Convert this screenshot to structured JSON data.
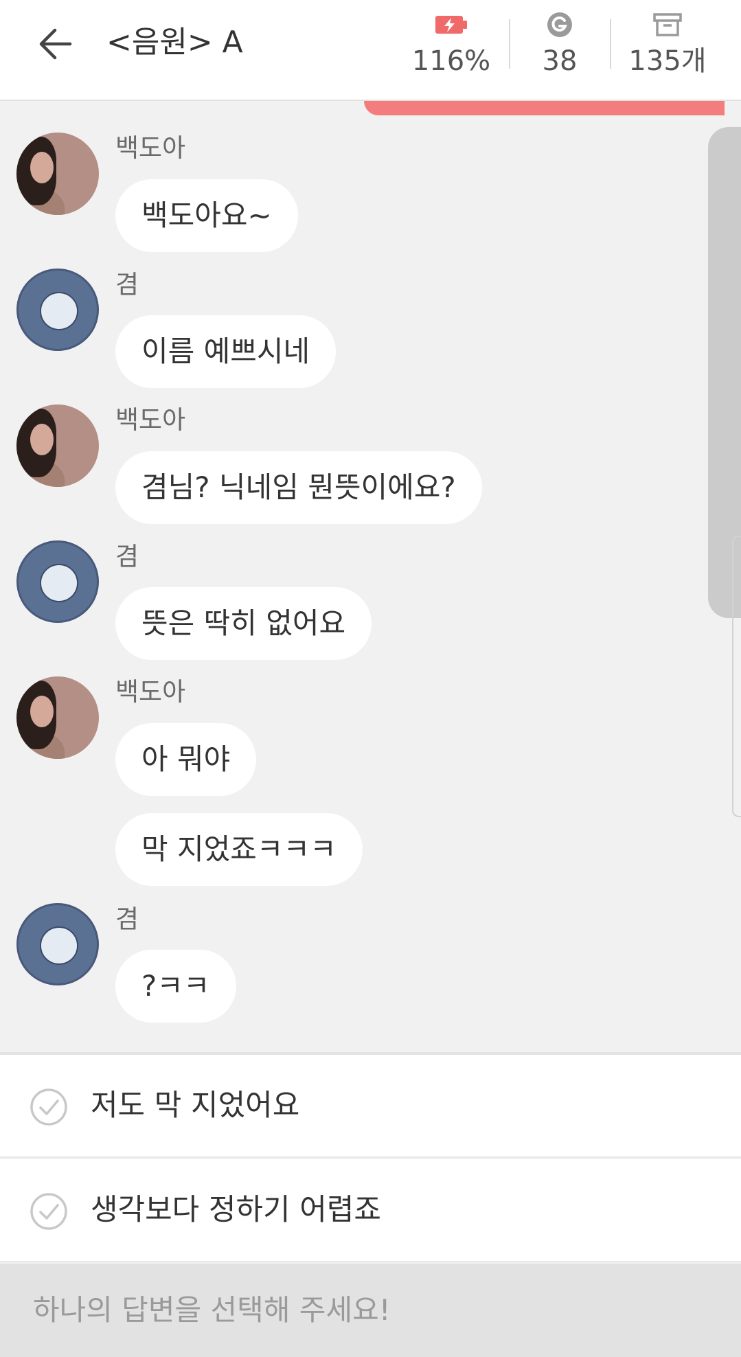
{
  "header": {
    "title": "<음원> A",
    "stats": [
      {
        "icon": "battery-charging-icon",
        "value": "116%"
      },
      {
        "icon": "g-coin-icon",
        "value": "38"
      },
      {
        "icon": "archive-box-icon",
        "value": "135개"
      }
    ]
  },
  "colors": {
    "accent": "#f37c7c",
    "battery": "#f06a6a",
    "icon_gray": "#9a9a9a"
  },
  "chat": {
    "messages": [
      {
        "sender": "백도아",
        "text": "백도아요~"
      },
      {
        "sender": "겸",
        "text": "이름 예쁘시네"
      },
      {
        "sender": "백도아",
        "text": "겸님? 닉네임 뭔뜻이에요?"
      },
      {
        "sender": "겸",
        "text": "뜻은 딱히 없어요"
      },
      {
        "sender": "백도아",
        "text": "아 뭐야"
      },
      {
        "sender": "",
        "text": "막 지었죠ㅋㅋㅋ"
      },
      {
        "sender": "겸",
        "text": "?ㅋㅋ"
      }
    ]
  },
  "options": [
    {
      "text": "저도 막 지었어요"
    },
    {
      "text": "생각보다 정하기 어렵죠"
    }
  ],
  "footer": {
    "prompt": "하나의 답변을 선택해 주세요!"
  }
}
